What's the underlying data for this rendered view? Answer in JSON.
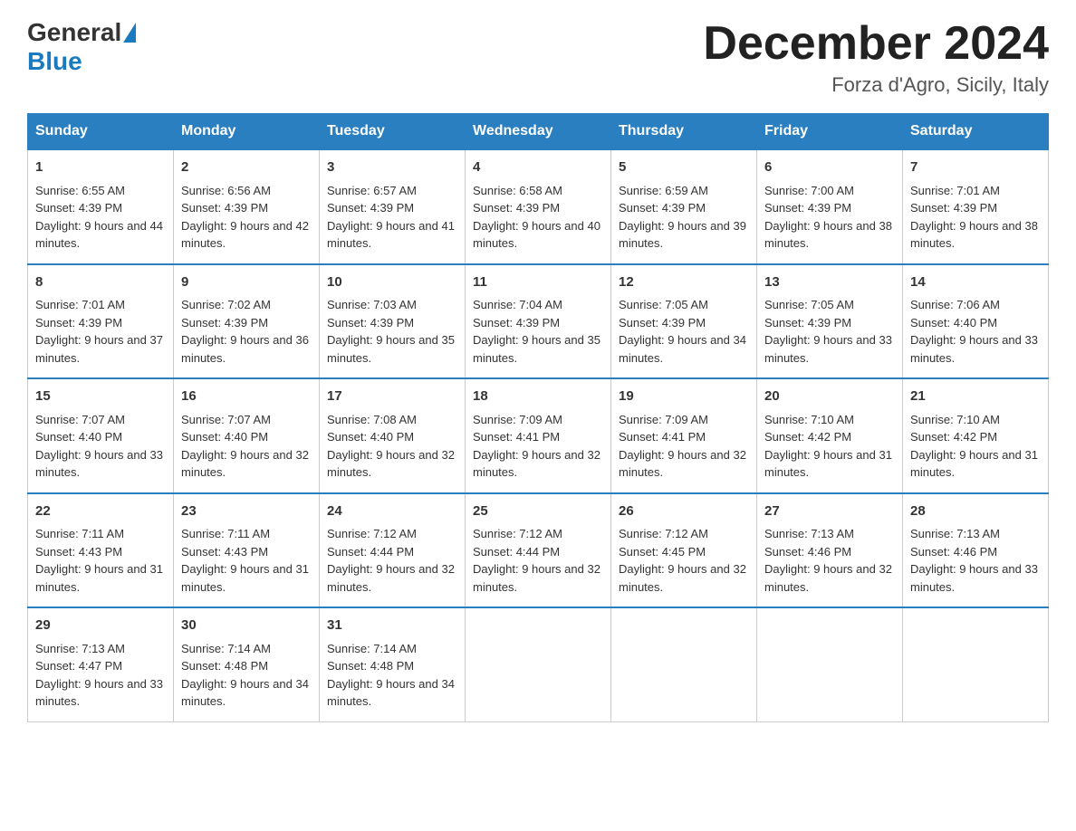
{
  "header": {
    "logo_general": "General",
    "logo_blue": "Blue",
    "month_title": "December 2024",
    "location": "Forza d'Agro, Sicily, Italy"
  },
  "weekdays": [
    "Sunday",
    "Monday",
    "Tuesday",
    "Wednesday",
    "Thursday",
    "Friday",
    "Saturday"
  ],
  "weeks": [
    [
      {
        "day": "1",
        "sunrise": "6:55 AM",
        "sunset": "4:39 PM",
        "daylight": "9 hours and 44 minutes."
      },
      {
        "day": "2",
        "sunrise": "6:56 AM",
        "sunset": "4:39 PM",
        "daylight": "9 hours and 42 minutes."
      },
      {
        "day": "3",
        "sunrise": "6:57 AM",
        "sunset": "4:39 PM",
        "daylight": "9 hours and 41 minutes."
      },
      {
        "day": "4",
        "sunrise": "6:58 AM",
        "sunset": "4:39 PM",
        "daylight": "9 hours and 40 minutes."
      },
      {
        "day": "5",
        "sunrise": "6:59 AM",
        "sunset": "4:39 PM",
        "daylight": "9 hours and 39 minutes."
      },
      {
        "day": "6",
        "sunrise": "7:00 AM",
        "sunset": "4:39 PM",
        "daylight": "9 hours and 38 minutes."
      },
      {
        "day": "7",
        "sunrise": "7:01 AM",
        "sunset": "4:39 PM",
        "daylight": "9 hours and 38 minutes."
      }
    ],
    [
      {
        "day": "8",
        "sunrise": "7:01 AM",
        "sunset": "4:39 PM",
        "daylight": "9 hours and 37 minutes."
      },
      {
        "day": "9",
        "sunrise": "7:02 AM",
        "sunset": "4:39 PM",
        "daylight": "9 hours and 36 minutes."
      },
      {
        "day": "10",
        "sunrise": "7:03 AM",
        "sunset": "4:39 PM",
        "daylight": "9 hours and 35 minutes."
      },
      {
        "day": "11",
        "sunrise": "7:04 AM",
        "sunset": "4:39 PM",
        "daylight": "9 hours and 35 minutes."
      },
      {
        "day": "12",
        "sunrise": "7:05 AM",
        "sunset": "4:39 PM",
        "daylight": "9 hours and 34 minutes."
      },
      {
        "day": "13",
        "sunrise": "7:05 AM",
        "sunset": "4:39 PM",
        "daylight": "9 hours and 33 minutes."
      },
      {
        "day": "14",
        "sunrise": "7:06 AM",
        "sunset": "4:40 PM",
        "daylight": "9 hours and 33 minutes."
      }
    ],
    [
      {
        "day": "15",
        "sunrise": "7:07 AM",
        "sunset": "4:40 PM",
        "daylight": "9 hours and 33 minutes."
      },
      {
        "day": "16",
        "sunrise": "7:07 AM",
        "sunset": "4:40 PM",
        "daylight": "9 hours and 32 minutes."
      },
      {
        "day": "17",
        "sunrise": "7:08 AM",
        "sunset": "4:40 PM",
        "daylight": "9 hours and 32 minutes."
      },
      {
        "day": "18",
        "sunrise": "7:09 AM",
        "sunset": "4:41 PM",
        "daylight": "9 hours and 32 minutes."
      },
      {
        "day": "19",
        "sunrise": "7:09 AM",
        "sunset": "4:41 PM",
        "daylight": "9 hours and 32 minutes."
      },
      {
        "day": "20",
        "sunrise": "7:10 AM",
        "sunset": "4:42 PM",
        "daylight": "9 hours and 31 minutes."
      },
      {
        "day": "21",
        "sunrise": "7:10 AM",
        "sunset": "4:42 PM",
        "daylight": "9 hours and 31 minutes."
      }
    ],
    [
      {
        "day": "22",
        "sunrise": "7:11 AM",
        "sunset": "4:43 PM",
        "daylight": "9 hours and 31 minutes."
      },
      {
        "day": "23",
        "sunrise": "7:11 AM",
        "sunset": "4:43 PM",
        "daylight": "9 hours and 31 minutes."
      },
      {
        "day": "24",
        "sunrise": "7:12 AM",
        "sunset": "4:44 PM",
        "daylight": "9 hours and 32 minutes."
      },
      {
        "day": "25",
        "sunrise": "7:12 AM",
        "sunset": "4:44 PM",
        "daylight": "9 hours and 32 minutes."
      },
      {
        "day": "26",
        "sunrise": "7:12 AM",
        "sunset": "4:45 PM",
        "daylight": "9 hours and 32 minutes."
      },
      {
        "day": "27",
        "sunrise": "7:13 AM",
        "sunset": "4:46 PM",
        "daylight": "9 hours and 32 minutes."
      },
      {
        "day": "28",
        "sunrise": "7:13 AM",
        "sunset": "4:46 PM",
        "daylight": "9 hours and 33 minutes."
      }
    ],
    [
      {
        "day": "29",
        "sunrise": "7:13 AM",
        "sunset": "4:47 PM",
        "daylight": "9 hours and 33 minutes."
      },
      {
        "day": "30",
        "sunrise": "7:14 AM",
        "sunset": "4:48 PM",
        "daylight": "9 hours and 34 minutes."
      },
      {
        "day": "31",
        "sunrise": "7:14 AM",
        "sunset": "4:48 PM",
        "daylight": "9 hours and 34 minutes."
      },
      null,
      null,
      null,
      null
    ]
  ]
}
